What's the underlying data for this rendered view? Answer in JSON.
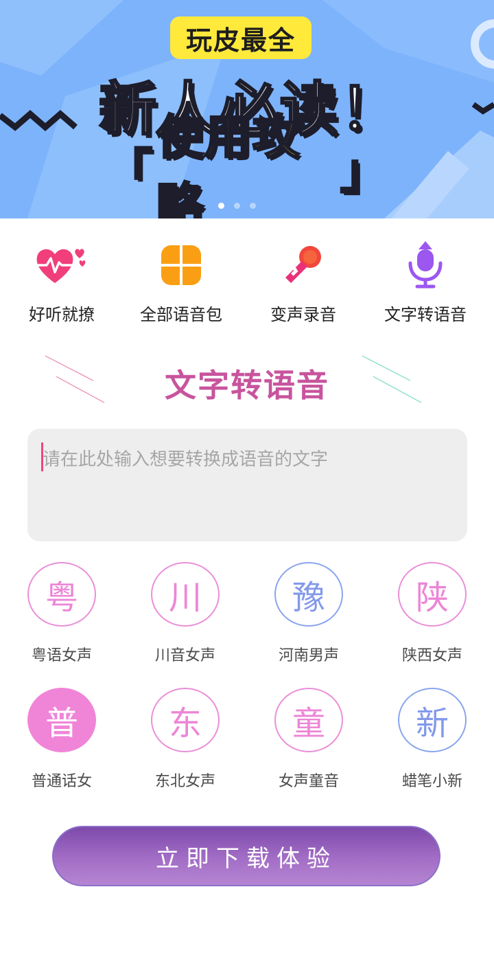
{
  "banner": {
    "tag": "玩皮最全",
    "title": "新人必读！",
    "subtitle_open": "「",
    "subtitle": "使用攻略",
    "subtitle_close": "」",
    "page_count": 3,
    "active_page": 1
  },
  "nav": {
    "items": [
      {
        "label": "好听就撩",
        "icon": "heart-pulse-icon"
      },
      {
        "label": "全部语音包",
        "icon": "four-petal-grid-icon"
      },
      {
        "label": "变声录音",
        "icon": "karaoke-mic-icon"
      },
      {
        "label": "文字转语音",
        "icon": "microphone-icon"
      }
    ]
  },
  "section": {
    "title": "文字转语音"
  },
  "input": {
    "placeholder": "请在此处输入想要转换成语音的文字",
    "value": ""
  },
  "voices": [
    {
      "char": "粤",
      "label": "粤语女声",
      "style": "pink"
    },
    {
      "char": "川",
      "label": "川音女声",
      "style": "pink"
    },
    {
      "char": "豫",
      "label": "河南男声",
      "style": "blue"
    },
    {
      "char": "陕",
      "label": "陕西女声",
      "style": "pink"
    },
    {
      "char": "普",
      "label": "普通话女",
      "style": "filled"
    },
    {
      "char": "东",
      "label": "东北女声",
      "style": "pink"
    },
    {
      "char": "童",
      "label": "女声童音",
      "style": "pink"
    },
    {
      "char": "新",
      "label": "蜡笔小新",
      "style": "blue"
    }
  ],
  "download": {
    "label": "立即下载体验"
  },
  "colors": {
    "banner_bg": "#7db3fb",
    "tag_yellow": "#ffe93b",
    "accent_pink": "#ec86d6",
    "accent_blue": "#8299ea",
    "button_purple": "#a36ec6"
  }
}
